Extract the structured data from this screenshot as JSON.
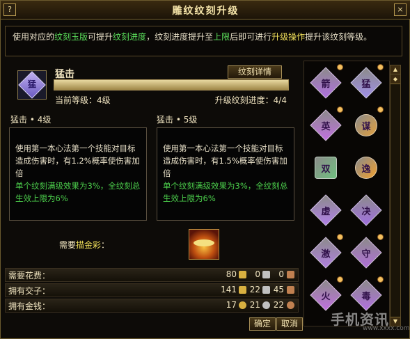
{
  "window": {
    "title": "雕纹纹刻升级",
    "help_label": "?",
    "close_label": "×"
  },
  "description": {
    "parts": [
      "使用对应的",
      "纹刻玉版",
      "可提升",
      "纹刻进度",
      "，纹刻进度提升至",
      "上限",
      "后即可进行",
      "升级操作",
      "提升该纹刻等级。"
    ]
  },
  "skill": {
    "name": "猛击",
    "icon_glyph": "猛",
    "detail_button": "纹刻详情",
    "current_level": "当前等级：4级",
    "upgrade_progress": "升级纹刻进度：4/4",
    "progress_fraction": 1.0
  },
  "levels": [
    {
      "title": "猛击 • 4级",
      "text": "使用第一本心法第一个技能对目标造成伤害时，有1.2%概率使伤害加倍",
      "green_text": "单个纹刻满级效果为3%，全纹刻总生效上限为6%"
    },
    {
      "title": "猛击 • 5级",
      "text": "使用第一本心法第一个技能对目标造成伤害时，有1.5%概率使伤害加倍",
      "green_text": "单个纹刻满级效果为3%，全纹刻总生效上限为6%"
    }
  ],
  "need": {
    "prefix": "需要",
    "item": "描金彩",
    "suffix": "："
  },
  "costs": [
    {
      "label": "需要花费：",
      "values": [
        "80",
        "0",
        "0"
      ]
    },
    {
      "label": "拥有交子：",
      "values": [
        "141",
        "22",
        "45"
      ]
    },
    {
      "label": "拥有金钱：",
      "values": [
        "17",
        "21",
        "22"
      ]
    }
  ],
  "buttons": {
    "confirm": "确定",
    "cancel": "取消"
  },
  "grid": [
    {
      "glyph": "箭",
      "color": "#b070e0",
      "shape": "diamond",
      "dot": true
    },
    {
      "glyph": "猛",
      "color": "#a090e8",
      "shape": "diamond",
      "dot": true
    },
    {
      "glyph": "英",
      "color": "#c070e0",
      "shape": "diamond",
      "dot": true
    },
    {
      "glyph": "谋",
      "color": "#e0a040",
      "shape": "round",
      "dot": true
    },
    {
      "glyph": "双",
      "color": "#70c080",
      "shape": "square",
      "dot": false
    },
    {
      "glyph": "逸",
      "color": "#f0a030",
      "shape": "round",
      "dot": false
    },
    {
      "glyph": "虚",
      "color": "#b080e8",
      "shape": "diamond",
      "dot": false
    },
    {
      "glyph": "决",
      "color": "#a070e0",
      "shape": "diamond",
      "dot": false
    },
    {
      "glyph": "激",
      "color": "#b080e0",
      "shape": "diamond",
      "dot": true
    },
    {
      "glyph": "守",
      "color": "#b070d8",
      "shape": "diamond",
      "dot": true
    },
    {
      "glyph": "火",
      "color": "#c070e0",
      "shape": "diamond",
      "dot": true
    },
    {
      "glyph": "毒",
      "color": "#b070e0",
      "shape": "diamond",
      "dot": true
    }
  ],
  "watermark": {
    "text": "手机资讯",
    "url": "www.xxxx.com"
  },
  "colors": {
    "accent_green": "#4cd04c",
    "accent_yellow": "#f4e35c",
    "frame_gold": "#a89058"
  }
}
